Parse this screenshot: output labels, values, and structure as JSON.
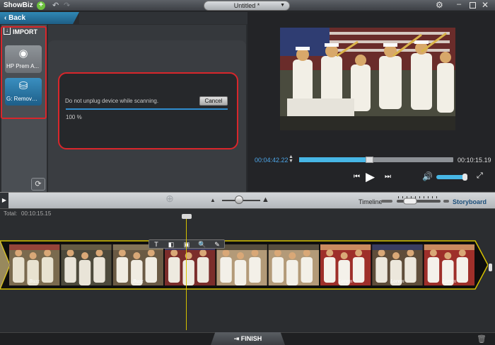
{
  "window": {
    "app_name": "ShowBiz",
    "project_title": "Untitled *"
  },
  "nav": {
    "back_label": "Back"
  },
  "import_panel": {
    "header": "IMPORT",
    "devices": [
      {
        "label": "HP Prem A...",
        "icon": "webcam-icon"
      },
      {
        "label": "G: Removable...",
        "icon": "removable-drive-icon"
      }
    ],
    "highlight_color": "#d9262b"
  },
  "scan_dialog": {
    "message": "Do not unplug device while scanning.",
    "cancel_label": "Cancel",
    "progress_text": "100 %",
    "progress": 1.0
  },
  "player": {
    "current_time": "00:04:42.22",
    "total_time": "00:10:15.19",
    "position_fraction": 0.44,
    "volume_fraction": 0.9
  },
  "toolbar": {
    "timeline_label": "Timeline",
    "storyboard_label": "Storyboard"
  },
  "timeline": {
    "total_label": "Total:",
    "total_value": "00:10:15.15",
    "clip_tools": [
      "T",
      "◧",
      "▣",
      "🔍",
      "✎"
    ],
    "frames": [
      {
        "scene": "banner",
        "tag": "Buzz"
      },
      {
        "scene": "crowd",
        "tag": ""
      },
      {
        "scene": "stage",
        "tag": "Buzz"
      },
      {
        "scene": "flag",
        "tag": ""
      },
      {
        "scene": "sailor",
        "tag": ""
      },
      {
        "scene": "sailor",
        "tag": ""
      },
      {
        "scene": "closeup",
        "tag": "Lorem"
      },
      {
        "scene": "band",
        "tag": "Lorem"
      },
      {
        "scene": "closeup",
        "tag": "Lorem"
      }
    ]
  },
  "bottom": {
    "finish_label": "FINISH"
  },
  "colors": {
    "accent": "#2f88b5",
    "highlight": "#d9262b",
    "timeline_border": "#d6c200"
  }
}
